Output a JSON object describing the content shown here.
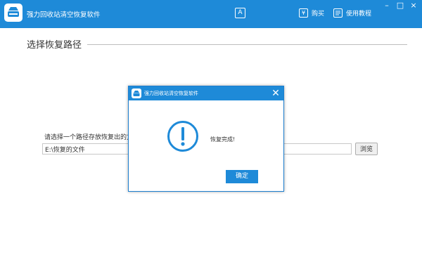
{
  "app": {
    "title": "强力回收站清空恢复软件"
  },
  "toolbar": {
    "a_icon_label": "A",
    "buy": {
      "icon": "¥",
      "label": "购买"
    },
    "tutorial": {
      "label": "使用教程"
    }
  },
  "window_controls": {
    "minimize": "–",
    "maximize": "□",
    "close": "×"
  },
  "section": {
    "title": "选择恢复路径"
  },
  "form": {
    "prompt": "请选择一个路径存放恢复出的文",
    "path_value": "E:\\恢复的文件",
    "browse_label": "浏览"
  },
  "dialog": {
    "title": "强力回收站清空恢复软件",
    "message": "恢复完成!",
    "ok_label": "确定",
    "icon": "exclamation-circle-icon"
  },
  "colors": {
    "accent": "#1e8ad8",
    "background": "#ffffff"
  }
}
